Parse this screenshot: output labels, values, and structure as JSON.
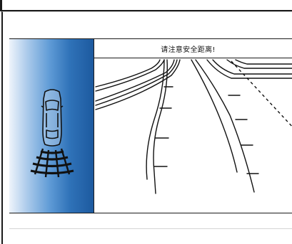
{
  "display": {
    "warning_text": "请注意安全距离!"
  },
  "sensor_view": {
    "vehicle_icon": "car-top-view-icon",
    "sensor_icon": "parking-sensor-arcs-icon"
  },
  "camera_view": {
    "guide_lines_icon": "parking-guide-lines-icon"
  },
  "colors": {
    "sensor_panel_dark": "#1d5a9f",
    "sensor_panel_light": "#eef4fb",
    "line_color": "#1a1a1a"
  }
}
